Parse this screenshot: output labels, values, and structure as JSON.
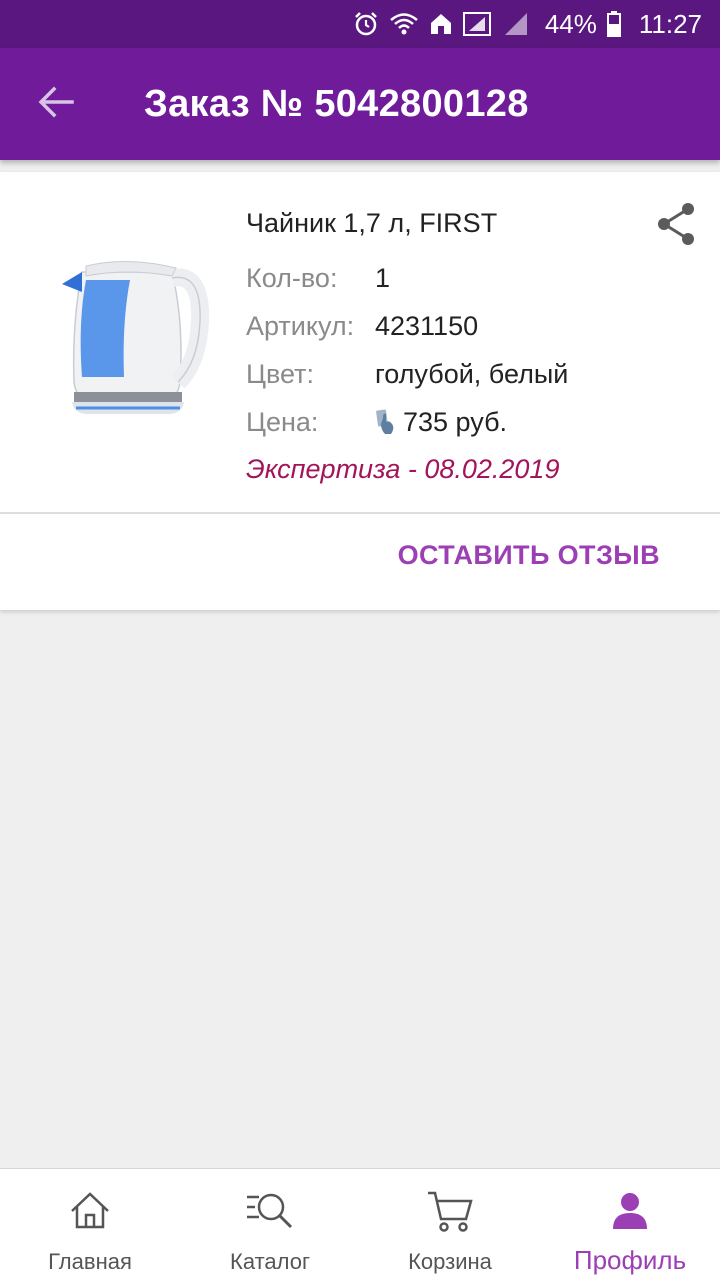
{
  "status_bar": {
    "battery": "44%",
    "time": "11:27"
  },
  "header": {
    "title": "Заказ № 5042800128",
    "back_icon": "arrow-left-icon"
  },
  "order_item": {
    "name": "Чайник 1,7 л, FIRST",
    "image_alt": "kettle-image",
    "details": [
      {
        "label": "Кол-во:",
        "value": "1"
      },
      {
        "label": "Артикул:",
        "value": "4231150"
      },
      {
        "label": "Цвет:",
        "value": "голубой, белый"
      },
      {
        "label": "Цена:",
        "value": "735 руб."
      }
    ],
    "status": "Экспертиза - 08.02.2019",
    "review_button": "ОСТАВИТЬ ОТЗЫВ"
  },
  "bottom_nav": {
    "items": [
      {
        "label": "Главная",
        "icon": "home-icon"
      },
      {
        "label": "Каталог",
        "icon": "catalog-search-icon"
      },
      {
        "label": "Корзина",
        "icon": "cart-icon"
      },
      {
        "label": "Профиль",
        "icon": "profile-icon",
        "active": true
      }
    ]
  },
  "colors": {
    "app_bar": "#6f1b9a",
    "status_bar": "#5a1780",
    "accent": "#9c3fb4",
    "status_text": "#a3145a"
  }
}
